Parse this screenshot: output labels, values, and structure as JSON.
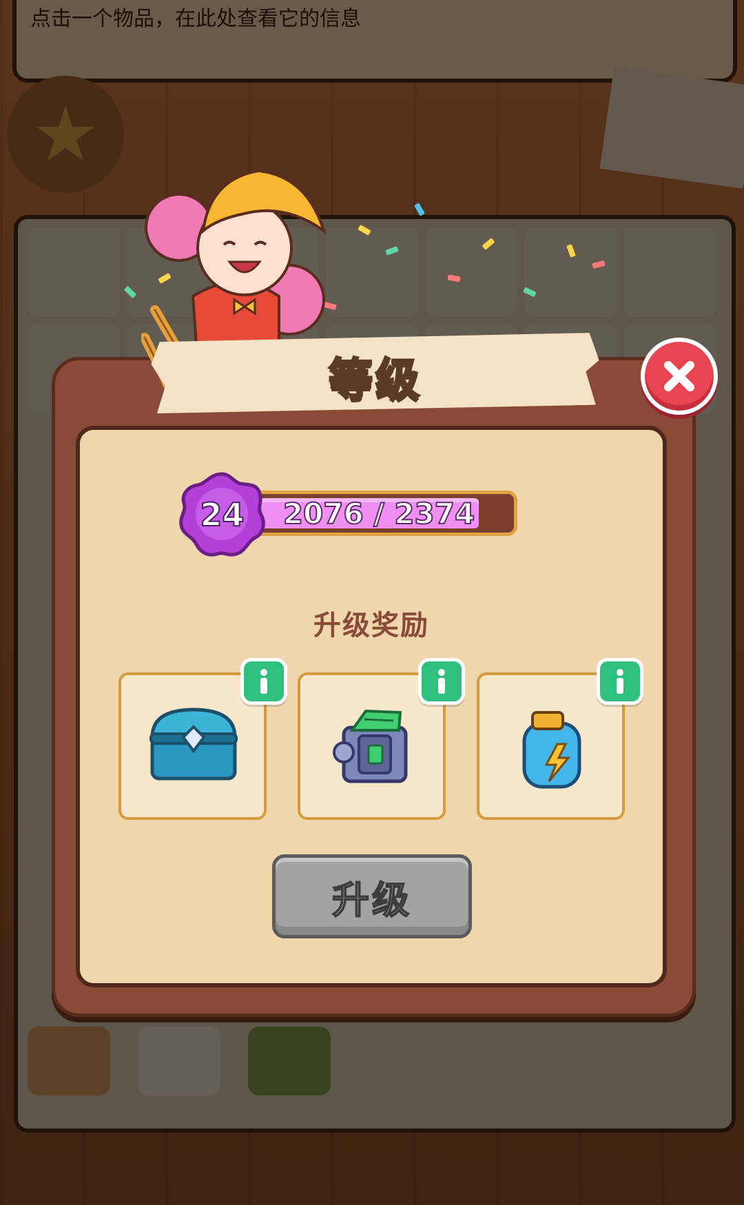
{
  "background": {
    "top_panel_text": "点击一个物品，在此处查看它的信息"
  },
  "dialog": {
    "title": "等级",
    "level": {
      "number": "24",
      "progress_text": "2076 / 2374",
      "current_xp": 2076,
      "required_xp": 2374
    },
    "rewards_title": "升级奖励",
    "rewards": [
      {
        "icon": "treasure-chest-icon"
      },
      {
        "icon": "money-safe-icon"
      },
      {
        "icon": "energy-jar-icon"
      }
    ],
    "upgrade_label": "升级"
  },
  "colors": {
    "dialog_frame": "#8a4a38",
    "inner_panel": "#efd6ac",
    "xp_fill": "#ef8ff1",
    "close_button": "#e94452",
    "info_button": "#2fbf7f",
    "upgrade_button_disabled": "#a3a3a3"
  }
}
